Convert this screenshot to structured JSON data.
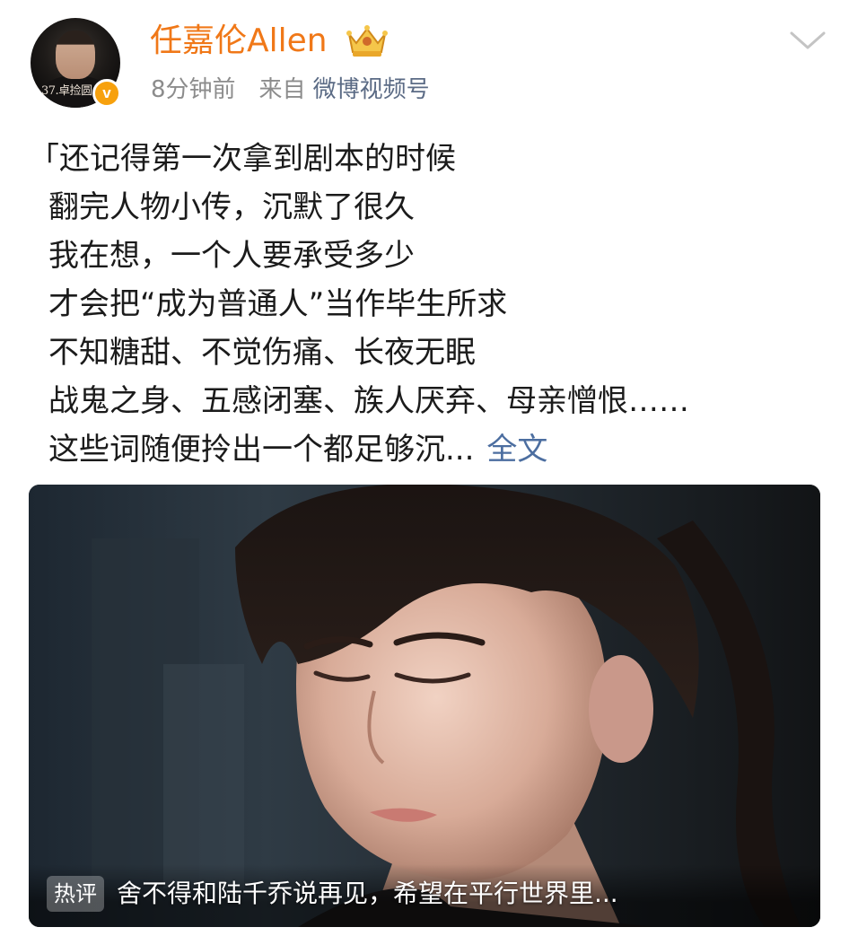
{
  "author": {
    "name": "任嘉伦Allen",
    "avatar_text": "37.卓捡圆",
    "verified_icon": "v",
    "crown_icon": "crown-icon"
  },
  "meta": {
    "time": "8分钟前",
    "from_label": "来自",
    "source": "微博视频号"
  },
  "post": {
    "lines": [
      "「还记得第一次拿到剧本的时候",
      "翻完人物小传，沉默了很久",
      "我在想，一个人要承受多少",
      "才会把“成为普通人”当作毕生所求",
      "不知糖甜、不觉伤痛、长夜无眠",
      "战鬼之身、五感闭塞、族人厌弃、母亲憎恨……",
      "这些词随便拎出一个都足够沉..."
    ],
    "full_text_link": "全文"
  },
  "video": {
    "hot_label": "热评",
    "hot_comment": "舍不得和陆千乔说再见，希望在平行世界里..."
  },
  "colors": {
    "username": "#f07818",
    "link": "#4c6ea0",
    "meta": "#8c8c8c",
    "badge": "#f7a10d"
  }
}
